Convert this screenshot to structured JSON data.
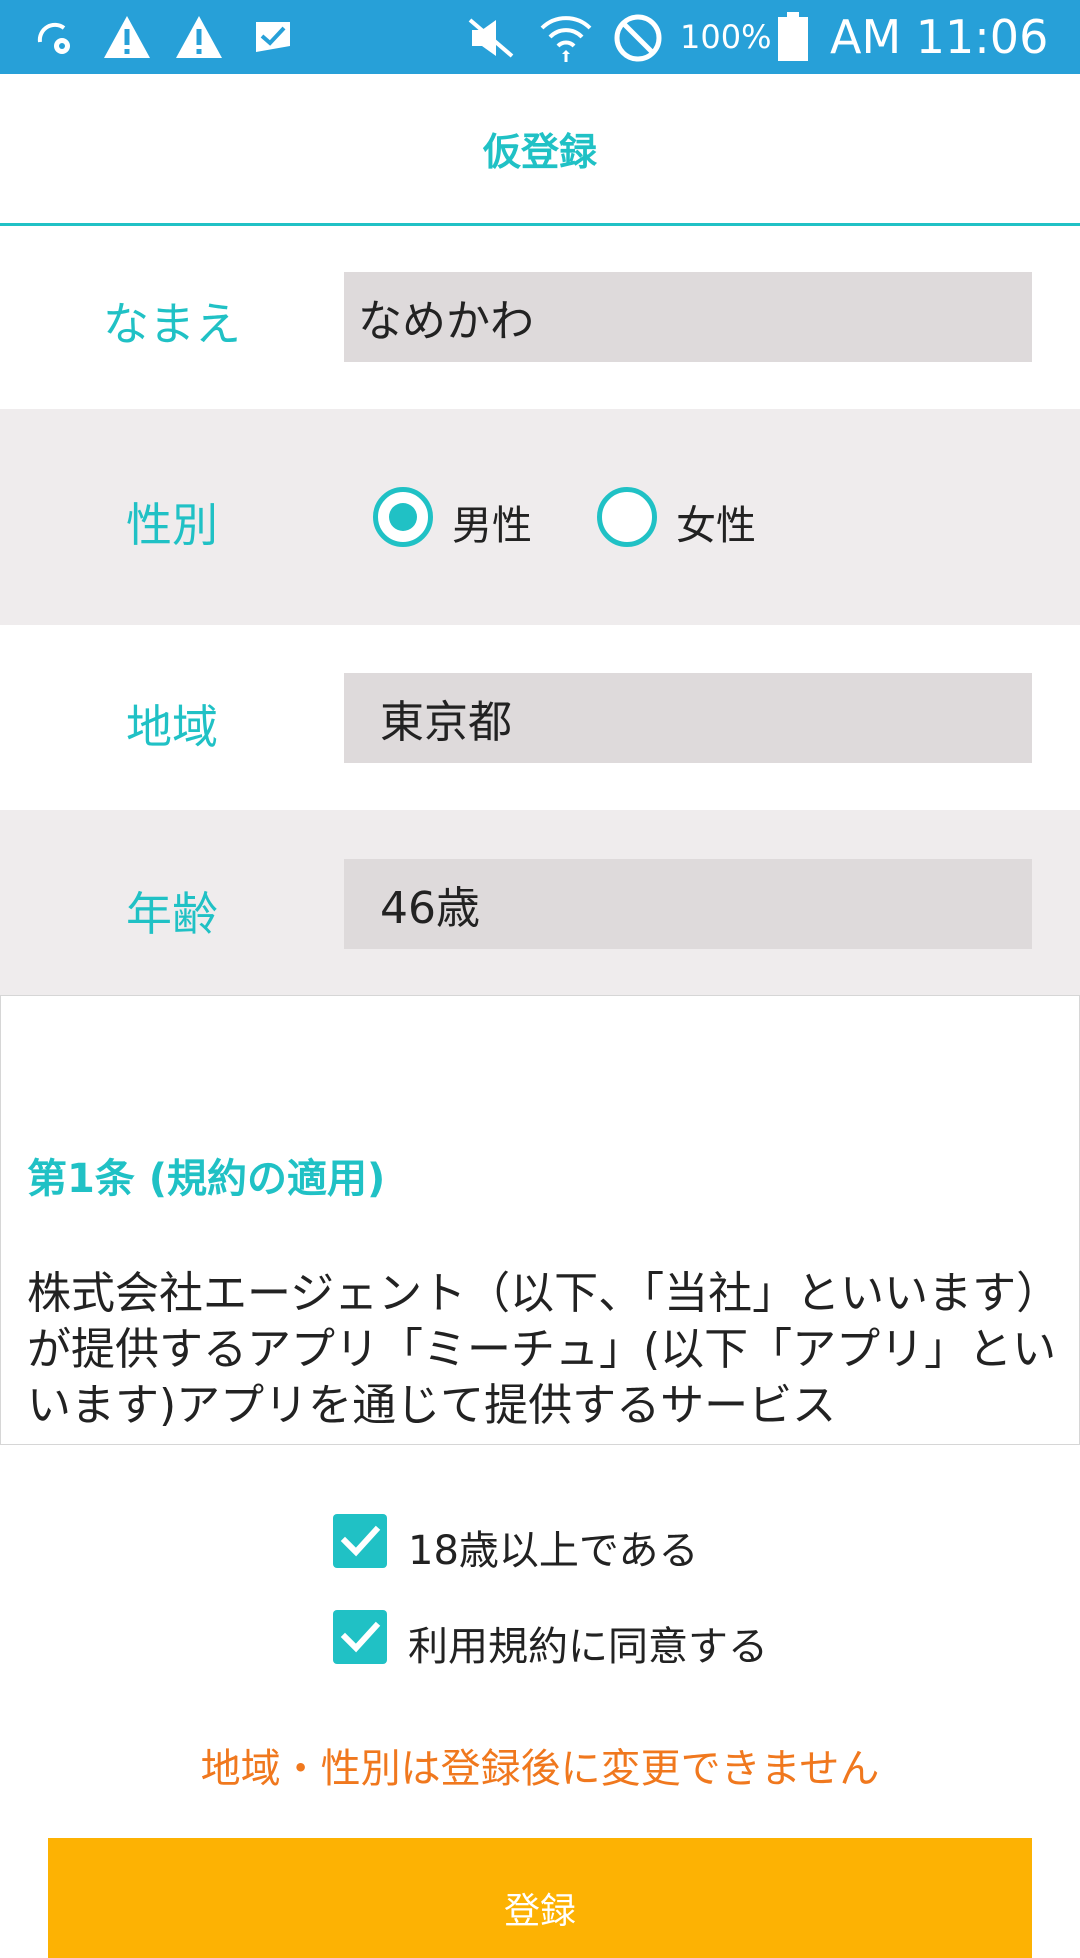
{
  "status_bar": {
    "battery": "100%",
    "time": "AM 11:06",
    "icons": [
      "sync-settings-icon",
      "warning-icon",
      "warning-icon",
      "mail-check-icon",
      "mute-icon",
      "wifi-icon",
      "blocked-icon",
      "battery-icon"
    ]
  },
  "header": {
    "title": "仮登録"
  },
  "form": {
    "name": {
      "label": "なまえ",
      "value": "なめかわ"
    },
    "gender": {
      "label": "性別",
      "options": [
        {
          "label": "男性",
          "selected": true
        },
        {
          "label": "女性",
          "selected": false
        }
      ]
    },
    "region": {
      "label": "地域",
      "value": "東京都"
    },
    "age": {
      "label": "年齢",
      "value": "46歳"
    }
  },
  "terms": {
    "heading": "第1条 (規約の適用)",
    "body": "株式会社エージェント（以下、「当社」といいます）が提供するアプリ「ミーチュ」(以下「アプリ」といいます)アプリを通じて提供するサービス"
  },
  "checks": [
    {
      "label": "18歳以上である",
      "checked": true
    },
    {
      "label": "利用規約に同意する",
      "checked": true
    }
  ],
  "notice": "地域・性別は登録後に変更できません",
  "register_label": "登録",
  "colors": {
    "accent": "#20c1c5",
    "status_bar": "#27a0d8",
    "notice": "#f0781e",
    "button": "#fdb203",
    "input_bg": "#dedadb",
    "alt_row_bg": "#efeced"
  }
}
